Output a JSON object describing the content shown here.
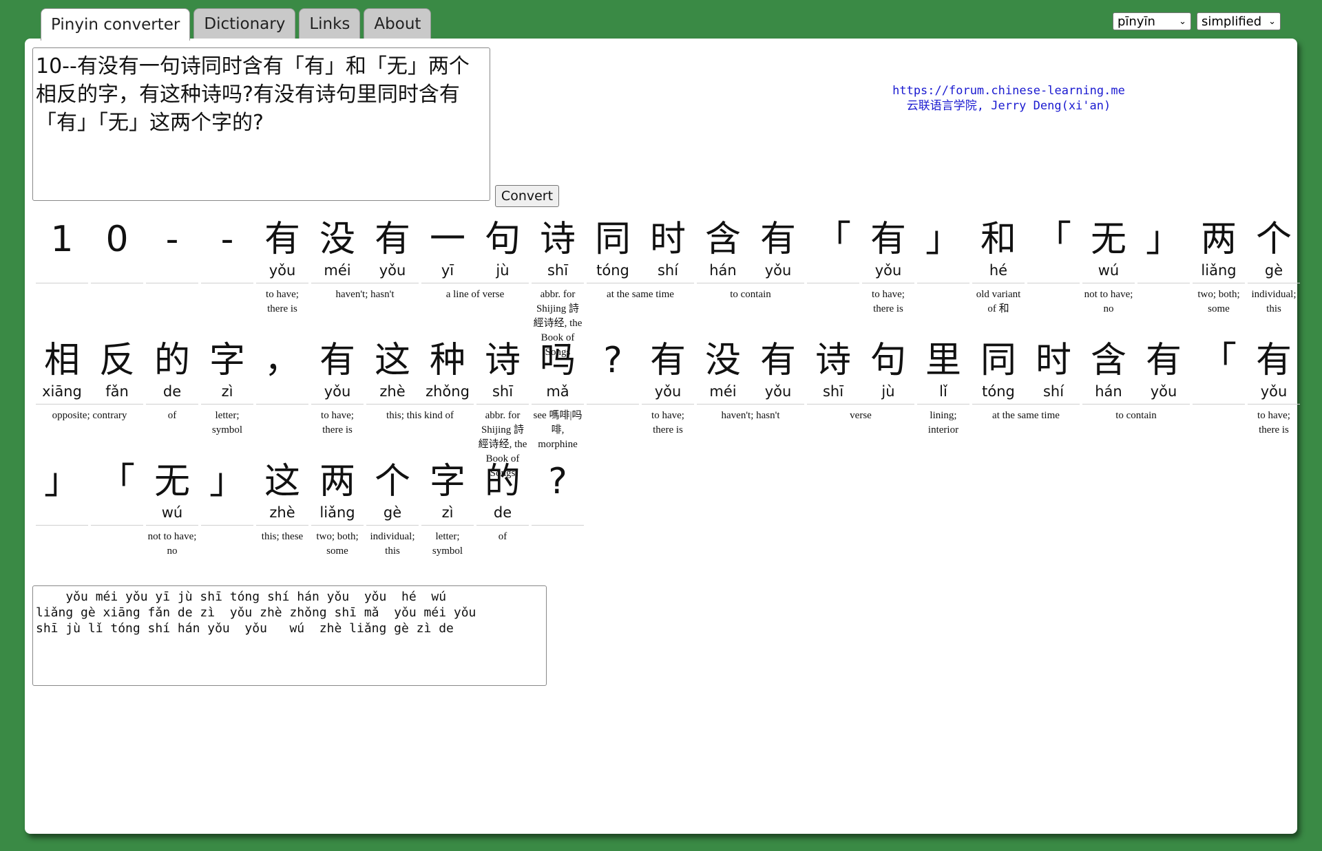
{
  "tabs": [
    "Pinyin converter",
    "Dictionary",
    "Links",
    "About"
  ],
  "selects": {
    "romanization": "pīnyīn",
    "script": "simplified"
  },
  "input_text": "10--有没有一句诗同时含有「有」和「无」两个相反的字，有这种诗吗?有没有诗句里同时含有「有」「无」这两个字的?",
  "convert_label": "Convert",
  "credit": {
    "url": "https://forum.chinese-learning.me",
    "name": "云联语言学院, Jerry Deng(xi'an)"
  },
  "rows": [
    [
      {
        "w": 80,
        "h": [
          "1"
        ]
      },
      {
        "w": 80,
        "h": [
          "0"
        ]
      },
      {
        "w": 80,
        "h": [
          "-"
        ]
      },
      {
        "w": 80,
        "h": [
          "-"
        ]
      },
      {
        "w": 80,
        "h": [
          "有"
        ],
        "p": [
          "yǒu"
        ],
        "d": "to have; there is"
      },
      {
        "w": 160,
        "h": [
          "没",
          "有"
        ],
        "p": [
          "méi",
          "yǒu"
        ],
        "d": "haven't; hasn't"
      },
      {
        "w": 160,
        "h": [
          "一",
          "句"
        ],
        "p": [
          "yī",
          "jù"
        ],
        "d": "a line of verse"
      },
      {
        "w": 80,
        "h": [
          "诗"
        ],
        "p": [
          "shī"
        ],
        "d": "abbr. for Shijing 詩經诗经, the Book of Songs"
      },
      {
        "w": 160,
        "h": [
          "同",
          "时"
        ],
        "p": [
          "tóng",
          "shí"
        ],
        "d": "at the same time"
      },
      {
        "w": 160,
        "h": [
          "含",
          "有"
        ],
        "p": [
          "hán",
          "yǒu"
        ],
        "d": "to contain"
      },
      {
        "w": 80,
        "h": [
          "「"
        ]
      },
      {
        "w": 80,
        "h": [
          "有"
        ],
        "p": [
          "yǒu"
        ],
        "d": "to have; there is"
      },
      {
        "w": 80,
        "h": [
          "」"
        ]
      },
      {
        "w": 80,
        "h": [
          "和"
        ],
        "p": [
          "hé"
        ],
        "d": "old variant of 和"
      },
      {
        "w": 80,
        "h": [
          "「"
        ]
      },
      {
        "w": 80,
        "h": [
          "无"
        ],
        "p": [
          "wú"
        ],
        "d": "not to have; no"
      },
      {
        "w": 80,
        "h": [
          "」"
        ]
      },
      {
        "w": 80,
        "h": [
          "两"
        ],
        "p": [
          "liǎng"
        ],
        "d": "two; both; some"
      },
      {
        "w": 80,
        "h": [
          "个"
        ],
        "p": [
          "gè"
        ],
        "d": "individual; this"
      }
    ],
    [
      {
        "w": 160,
        "h": [
          "相",
          "反"
        ],
        "p": [
          "xiāng",
          "fǎn"
        ],
        "d": "opposite; contrary"
      },
      {
        "w": 80,
        "h": [
          "的"
        ],
        "p": [
          "de"
        ],
        "d": "of"
      },
      {
        "w": 80,
        "h": [
          "字"
        ],
        "p": [
          "zì"
        ],
        "d": "letter; symbol"
      },
      {
        "w": 80,
        "h": [
          "，"
        ]
      },
      {
        "w": 80,
        "h": [
          "有"
        ],
        "p": [
          "yǒu"
        ],
        "d": "to have; there is"
      },
      {
        "w": 160,
        "h": [
          "这",
          "种"
        ],
        "p": [
          "zhè",
          "zhǒng"
        ],
        "d": "this; this kind of"
      },
      {
        "w": 80,
        "h": [
          "诗"
        ],
        "p": [
          "shī"
        ],
        "d": "abbr. for Shijing 詩經诗经, the Book of Songs"
      },
      {
        "w": 80,
        "h": [
          "吗"
        ],
        "p": [
          "mǎ"
        ],
        "d": "see 嗎啡|吗啡, morphine"
      },
      {
        "w": 80,
        "h": [
          "?"
        ]
      },
      {
        "w": 80,
        "h": [
          "有"
        ],
        "p": [
          "yǒu"
        ],
        "d": "to have; there is"
      },
      {
        "w": 160,
        "h": [
          "没",
          "有"
        ],
        "p": [
          "méi",
          "yǒu"
        ],
        "d": "haven't; hasn't"
      },
      {
        "w": 160,
        "h": [
          "诗",
          "句"
        ],
        "p": [
          "shī",
          "jù"
        ],
        "d": "verse"
      },
      {
        "w": 80,
        "h": [
          "里"
        ],
        "p": [
          "lǐ"
        ],
        "d": "lining; interior"
      },
      {
        "w": 160,
        "h": [
          "同",
          "时"
        ],
        "p": [
          "tóng",
          "shí"
        ],
        "d": "at the same time"
      },
      {
        "w": 160,
        "h": [
          "含",
          "有"
        ],
        "p": [
          "hán",
          "yǒu"
        ],
        "d": "to contain"
      },
      {
        "w": 80,
        "h": [
          "「"
        ]
      },
      {
        "w": 80,
        "h": [
          "有"
        ],
        "p": [
          "yǒu"
        ],
        "d": "to have; there is"
      }
    ],
    [
      {
        "w": 80,
        "h": [
          "」"
        ]
      },
      {
        "w": 80,
        "h": [
          "「"
        ]
      },
      {
        "w": 80,
        "h": [
          "无"
        ],
        "p": [
          "wú"
        ],
        "d": "not to have; no"
      },
      {
        "w": 80,
        "h": [
          "」"
        ]
      },
      {
        "w": 80,
        "h": [
          "这"
        ],
        "p": [
          "zhè"
        ],
        "d": "this; these"
      },
      {
        "w": 80,
        "h": [
          "两"
        ],
        "p": [
          "liǎng"
        ],
        "d": "two; both; some"
      },
      {
        "w": 80,
        "h": [
          "个"
        ],
        "p": [
          "gè"
        ],
        "d": "individual; this"
      },
      {
        "w": 80,
        "h": [
          "字"
        ],
        "p": [
          "zì"
        ],
        "d": "letter; symbol"
      },
      {
        "w": 80,
        "h": [
          "的"
        ],
        "p": [
          "de"
        ],
        "d": "of"
      },
      {
        "w": 80,
        "h": [
          "?"
        ]
      }
    ]
  ],
  "output_text": "    yǒu méi yǒu yī jù shī tóng shí hán yǒu  yǒu  hé  wú\nliǎng gè xiāng fǎn de zì  yǒu zhè zhǒng shī mǎ  yǒu méi yǒu\nshī jù lǐ tóng shí hán yǒu  yǒu   wú  zhè liǎng gè zì de"
}
